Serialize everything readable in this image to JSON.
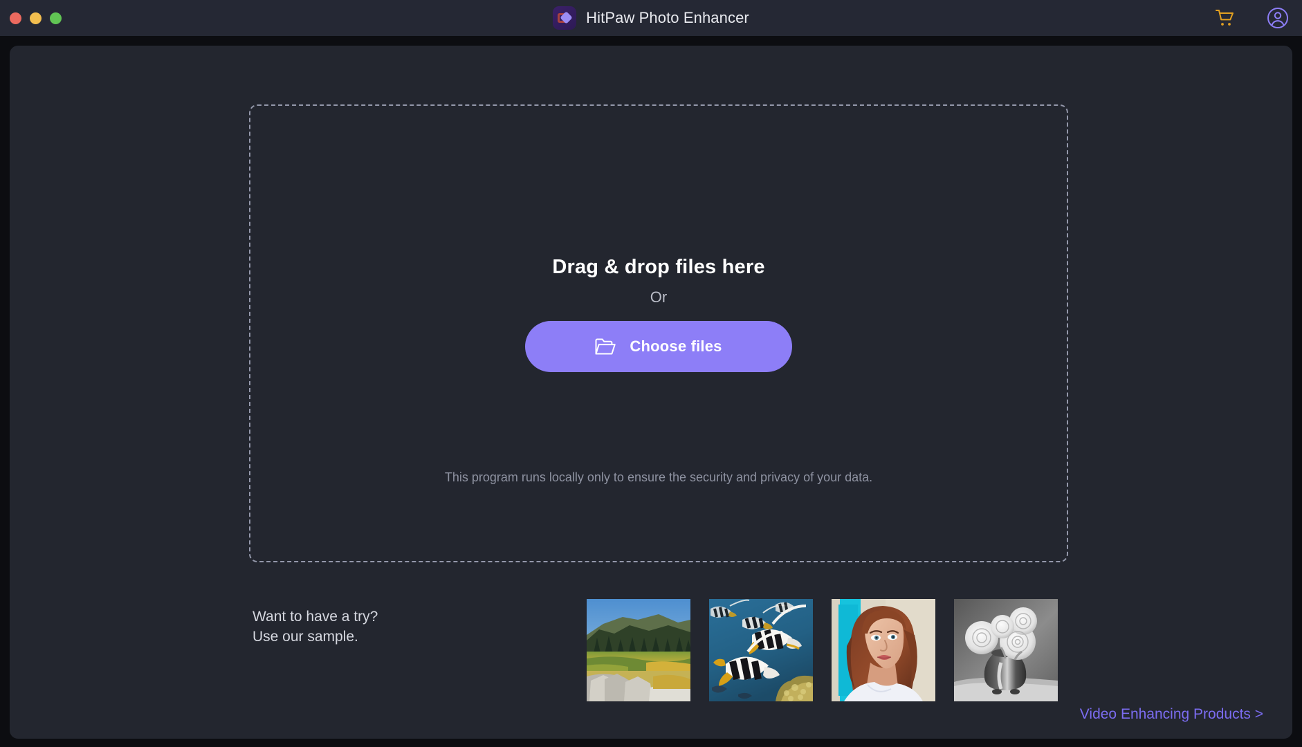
{
  "window": {
    "title": "HitPaw Photo Enhancer",
    "logo_icon": "hitpaw-logo-icon",
    "traffic_lights": [
      {
        "name": "close",
        "color": "#ec6a5f"
      },
      {
        "name": "minimize",
        "color": "#f2be4f"
      },
      {
        "name": "maximize",
        "color": "#61c554"
      }
    ],
    "actions": [
      {
        "name": "cart-icon",
        "color": "#e2a021"
      },
      {
        "name": "account-icon",
        "color": "#8d7ef7"
      }
    ]
  },
  "dropzone": {
    "headline": "Drag & drop files here",
    "or_label": "Or",
    "choose_files_label": "Choose files",
    "folder_icon": "folder-icon",
    "privacy_note": "This program runs locally only to ensure the security and privacy of your data."
  },
  "samples": {
    "prompt_line1": "Want to have a try?",
    "prompt_line2": "Use our sample.",
    "thumbnails": [
      {
        "name": "sample-landscape",
        "alt": "Mountain meadow landscape with pine trees and rocks"
      },
      {
        "name": "sample-fish",
        "alt": "Underwater bannerfish with coral reef"
      },
      {
        "name": "sample-portrait",
        "alt": "Portrait of a woman with auburn hair"
      },
      {
        "name": "sample-roses",
        "alt": "Black and white photo of roses in a vase"
      }
    ]
  },
  "footer": {
    "video_products_label": "Video Enhancing Products >"
  },
  "colors": {
    "accent_purple": "#8d7ef7",
    "link_purple": "#7b6cf0",
    "cart_yellow": "#e2a021",
    "titlebar_bg": "#252834",
    "content_bg": "#23262f",
    "window_bg": "#0c0d11",
    "dash_border": "#9498ab"
  }
}
